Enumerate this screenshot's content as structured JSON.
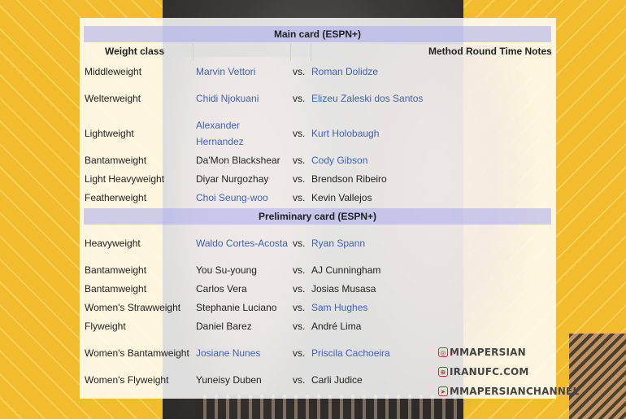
{
  "table": {
    "headers": {
      "weight_class": "Weight class",
      "method": "Method",
      "round": "Round",
      "time": "Time",
      "notes": "Notes"
    },
    "vs": "vs.",
    "main_card": {
      "title": "Main card (ESPN+)",
      "rows": [
        {
          "weight_class": "Middleweight",
          "fighter1": "Marvin Vettori",
          "fighter2": "Roman Dolidze"
        },
        {
          "weight_class": "Welterweight",
          "fighter1": "Chidi Njokuani",
          "fighter2": "Elizeu Zaleski dos Santos"
        },
        {
          "weight_class": "Lightweight",
          "fighter1": "Alexander Hernandez",
          "fighter2": "Kurt Holobaugh"
        },
        {
          "weight_class": "Bantamweight",
          "fighter1": "Da'Mon Blackshear",
          "fighter2": "Cody Gibson"
        },
        {
          "weight_class": "Light Heavyweight",
          "fighter1": "Diyar Nurgozhay",
          "fighter2": "Brendson Ribeiro"
        },
        {
          "weight_class": "Featherweight",
          "fighter1": "Choi Seung-woo",
          "fighter2": "Kevin Vallejos"
        }
      ]
    },
    "prelim_card": {
      "title": "Preliminary card (ESPN+)",
      "rows": [
        {
          "weight_class": "Heavyweight",
          "fighter1": "Waldo Cortes-Acosta",
          "fighter2": "Ryan Spann"
        },
        {
          "weight_class": "Bantamweight",
          "fighter1": "You Su-young",
          "fighter2": "AJ Cunningham"
        },
        {
          "weight_class": "Bantamweight",
          "fighter1": "Carlos Vera",
          "fighter2": "Josias Musasa"
        },
        {
          "weight_class": "Women's Strawweight",
          "fighter1": "Stephanie Luciano",
          "fighter2": "Sam Hughes"
        },
        {
          "weight_class": "Flyweight",
          "fighter1": "Daniel Barez",
          "fighter2": "André Lima"
        },
        {
          "weight_class": "Women's Bantamweight",
          "fighter1": "Josiane Nunes",
          "fighter2": "Priscila Cachoeira"
        },
        {
          "weight_class": "Women's Flyweight",
          "fighter1": "Yuneisy Duben",
          "fighter2": "Carli Judice"
        }
      ]
    }
  },
  "watermarks": [
    {
      "icon": "instagram-icon",
      "text": "MMAPERSIAN"
    },
    {
      "icon": "web-icon",
      "text": "IRANUFC.COM"
    },
    {
      "icon": "telegram-icon",
      "text": "MMAPERSIANCHANNEL"
    }
  ],
  "colors": {
    "link": "#3f62b8",
    "section_header": "#aaaaee",
    "background_yellow": "#f4c23a"
  }
}
